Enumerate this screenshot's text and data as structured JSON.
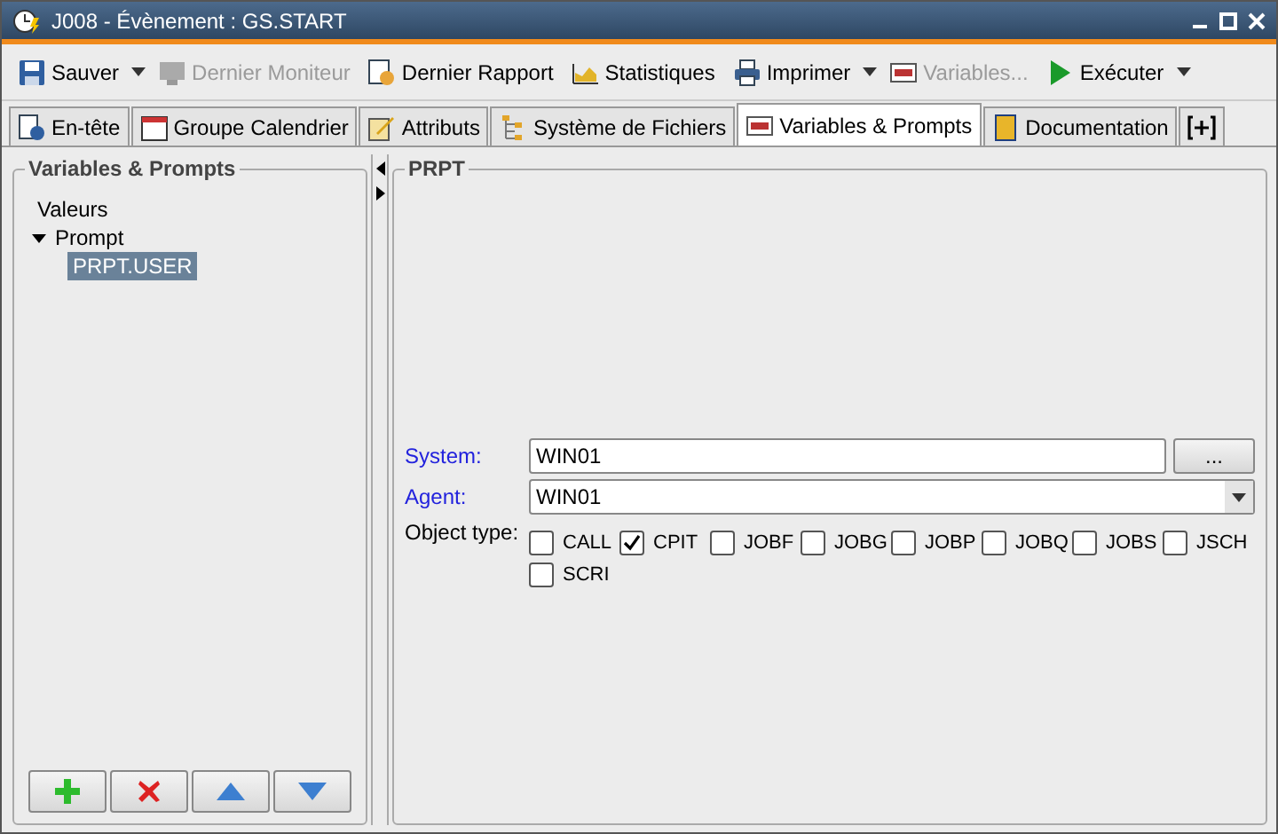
{
  "window": {
    "title": "J008 - Évènement : GS.START"
  },
  "toolbar": [
    {
      "label": "Sauver",
      "disabled": false,
      "dropdown": true
    },
    {
      "label": "Dernier Moniteur",
      "disabled": true,
      "dropdown": false
    },
    {
      "label": "Dernier Rapport",
      "disabled": false,
      "dropdown": false
    },
    {
      "label": "Statistiques",
      "disabled": false,
      "dropdown": false
    },
    {
      "label": "Imprimer",
      "disabled": false,
      "dropdown": true
    },
    {
      "label": "Variables...",
      "disabled": true,
      "dropdown": false
    },
    {
      "label": "Exécuter",
      "disabled": false,
      "dropdown": true
    }
  ],
  "tabs": [
    {
      "label": "En-tête",
      "selected": false
    },
    {
      "label": "Groupe Calendrier",
      "selected": false
    },
    {
      "label": "Attributs",
      "selected": false
    },
    {
      "label": "Système de Fichiers",
      "selected": false
    },
    {
      "label": "Variables & Prompts",
      "selected": true
    },
    {
      "label": "Documentation",
      "selected": false
    },
    {
      "selected": false
    }
  ],
  "tree": {
    "title": "Variables & Prompts",
    "items": [
      {
        "label": "Valeurs",
        "selected": false
      },
      {
        "label": "Prompt",
        "selected": false,
        "expanded": true,
        "children": [
          {
            "label": "PRPT.USER",
            "selected": true
          }
        ]
      }
    ]
  },
  "tree_buttons": [
    {
      "kind": "add"
    },
    {
      "kind": "delete"
    },
    {
      "kind": "up"
    },
    {
      "kind": "down"
    }
  ],
  "detail": {
    "title": "PRPT",
    "fields": [
      {
        "label": "System:",
        "value": "WIN01",
        "kind": "browse",
        "button": "..."
      },
      {
        "label": "Agent:",
        "value": "WIN01",
        "kind": "combo"
      }
    ],
    "object_type": {
      "label": "Object type:",
      "options": [
        {
          "label": "CALL",
          "checked": false
        },
        {
          "label": "CPIT",
          "checked": true
        },
        {
          "label": "JOBF",
          "checked": false
        },
        {
          "label": "JOBG",
          "checked": false
        },
        {
          "label": "JOBP",
          "checked": false
        },
        {
          "label": "JOBQ",
          "checked": false
        },
        {
          "label": "JOBS",
          "checked": false
        },
        {
          "label": "JSCH",
          "checked": false
        },
        {
          "label": "SCRI",
          "checked": false
        }
      ]
    }
  }
}
